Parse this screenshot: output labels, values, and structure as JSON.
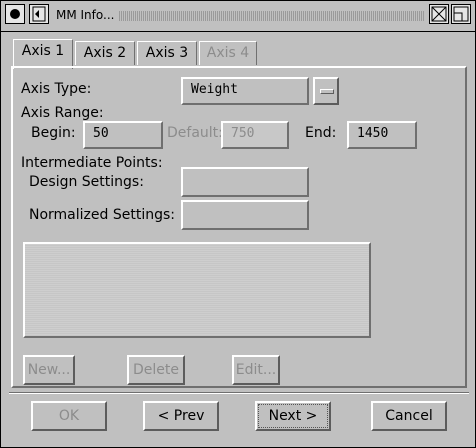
{
  "window": {
    "title": "MM Info..."
  },
  "titlebar": {
    "icons": [
      "close-box-icon",
      "menu-icon",
      "zoom-icon",
      "resize-icon"
    ]
  },
  "tabs": [
    {
      "label": "Axis 1",
      "active": true
    },
    {
      "label": "Axis 2",
      "active": false
    },
    {
      "label": "Axis 3",
      "active": false
    },
    {
      "label": "Axis 4",
      "active": false,
      "disabled": true
    }
  ],
  "axis_type": {
    "label": "Axis Type:",
    "value": "Weight"
  },
  "axis_range": {
    "label": "Axis Range:",
    "begin_label": "Begin:",
    "begin_value": "50",
    "default_label": "Default:",
    "default_value": "750",
    "end_label": "End:",
    "end_value": "1450"
  },
  "intermediate": {
    "label": "Intermediate Points:",
    "design_label": "Design Settings:",
    "design_value": "",
    "normalized_label": "Normalized Settings:",
    "normalized_value": ""
  },
  "list_buttons": {
    "new": "New...",
    "delete": "Delete",
    "edit": "Edit..."
  },
  "footer_buttons": {
    "ok": "OK",
    "prev": "< Prev",
    "next": "Next >",
    "cancel": "Cancel"
  }
}
